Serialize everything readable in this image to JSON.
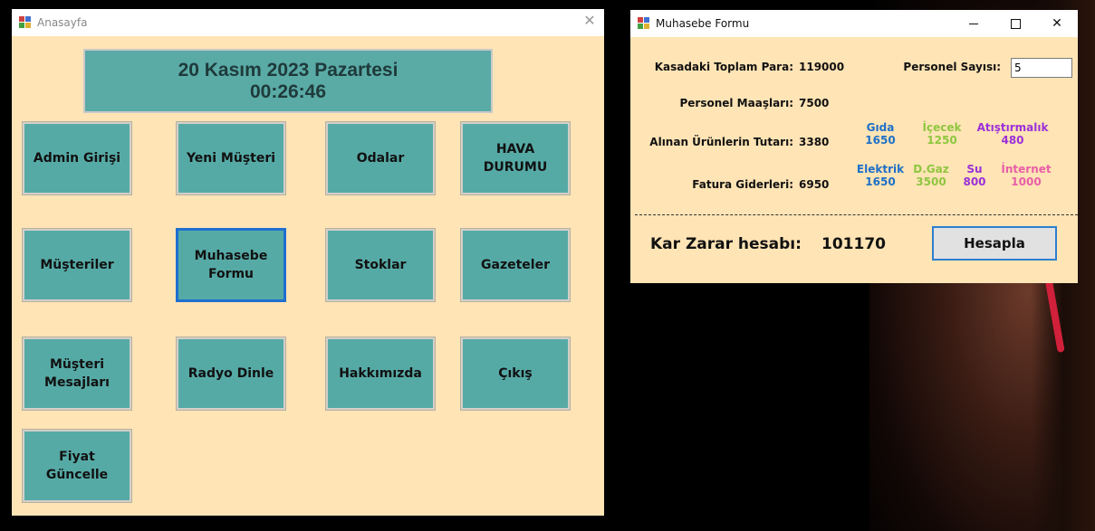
{
  "main_window": {
    "title": "Anasayfa",
    "close": "✕",
    "date": "20 Kasım 2023 Pazartesi",
    "time": "00:26:46",
    "tiles": [
      "Admin Girişi",
      "Yeni Müşteri",
      "Odalar",
      "HAVA\nDURUMU",
      "Müşteriler",
      "Muhasebe\nFormu",
      "Stoklar",
      "Gazeteler",
      "Müşteri\nMesajları",
      "Radyo Dinle",
      "Hakkımızda",
      "Çıkış",
      "Fiyat Güncelle"
    ]
  },
  "accounting_window": {
    "title": "Muhasebe Formu",
    "close": "✕",
    "kasa_label": "Kasadaki Toplam Para:",
    "kasa_value": "119000",
    "personel_count_label": "Personel Sayısı:",
    "personel_count_value": "5",
    "maas_label": "Personel Maaşları:",
    "maas_value": "7500",
    "urun_label": "Alınan Ürünlerin Tutarı:",
    "urun_value": "3380",
    "fatura_label": "Fatura Giderleri:",
    "fatura_value": "6950",
    "products": [
      {
        "name": "Gıda",
        "value": "1650",
        "color": "#1e6fc8"
      },
      {
        "name": "İçecek",
        "value": "1250",
        "color": "#8ec63f"
      },
      {
        "name": "Atıştırmalık",
        "value": "480",
        "color": "#9b30d9"
      }
    ],
    "bills": [
      {
        "name": "Elektrik",
        "value": "1650",
        "color": "#1e6fc8"
      },
      {
        "name": "D.Gaz",
        "value": "3500",
        "color": "#8ec63f"
      },
      {
        "name": "Su",
        "value": "800",
        "color": "#9b30d9"
      },
      {
        "name": "İnternet",
        "value": "1000",
        "color": "#e85fa8"
      }
    ],
    "kar_zarar_label": "Kar Zarar hesabı:",
    "kar_zarar_value": "101170",
    "hesapla_label": "Hesapla"
  }
}
